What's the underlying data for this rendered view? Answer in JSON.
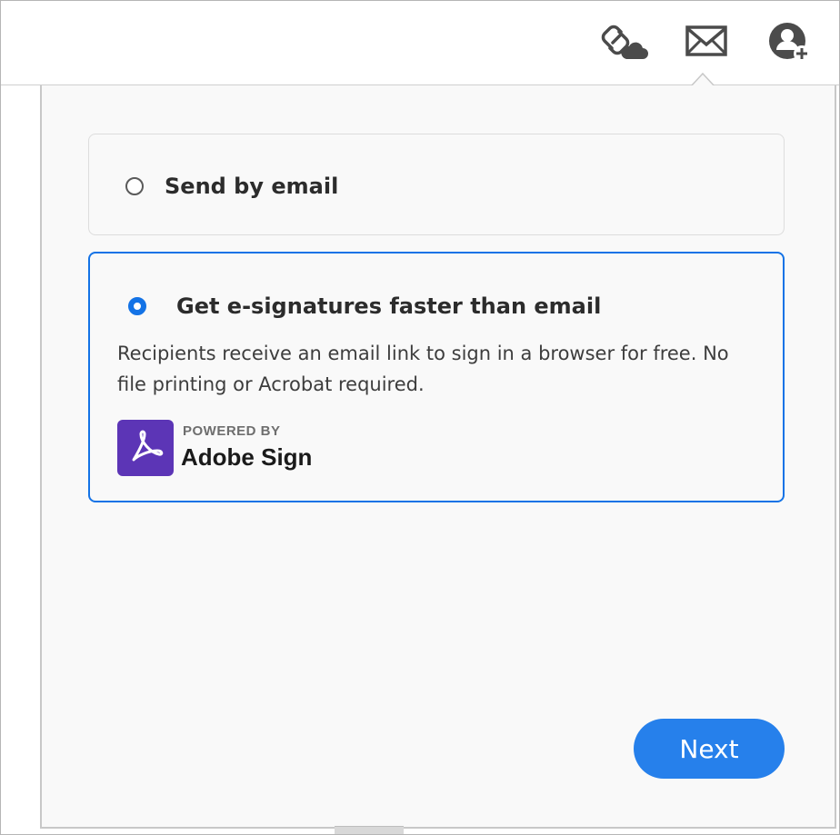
{
  "toolbar": {
    "icons": [
      "share-link-icon",
      "email-icon",
      "add-user-icon"
    ]
  },
  "options": {
    "email": {
      "label": "Send by email",
      "selected": false
    },
    "esign": {
      "label": "Get e-signatures faster than email",
      "description": "Recipients receive an email link to sign in a browser for free. No file printing or Acrobat required.",
      "powered_by": "POWERED BY",
      "brand": "Adobe Sign",
      "selected": true
    }
  },
  "actions": {
    "next_label": "Next"
  },
  "colors": {
    "accent": "#1473e6",
    "button": "#2680eb",
    "brand_logo": "#5c35b6"
  }
}
